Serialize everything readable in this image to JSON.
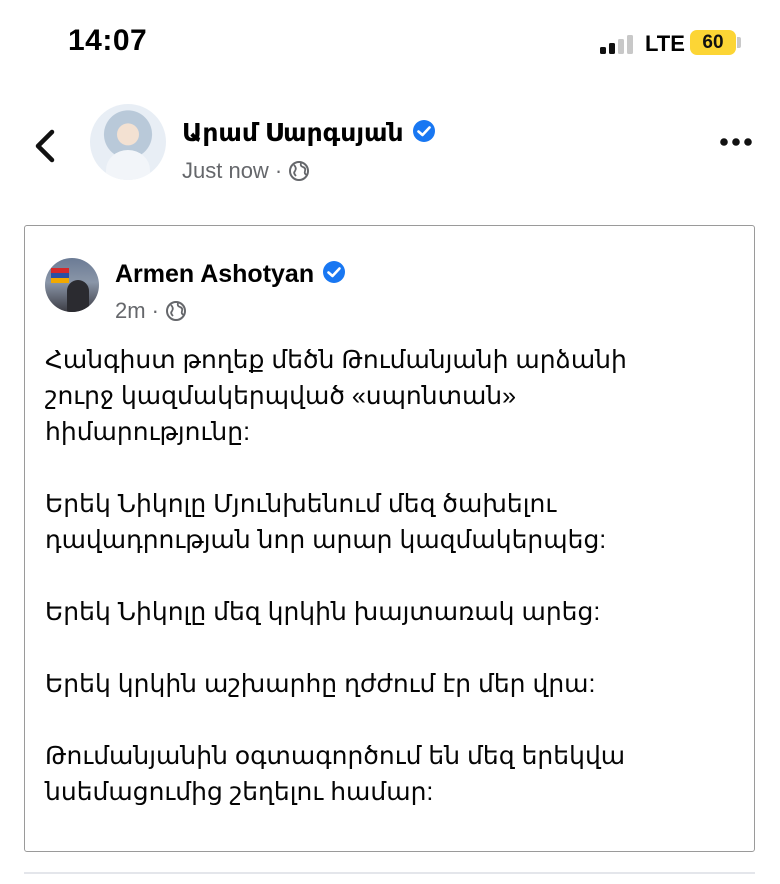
{
  "status_bar": {
    "time": "14:07",
    "network": "LTE",
    "battery": "60",
    "battery_color": "#fcd535",
    "signal_bars_filled": 2,
    "signal_bars_total": 4
  },
  "post": {
    "author": "Արամ Սարգսյան",
    "verified": true,
    "time": "Just now",
    "separator": "·",
    "audience_icon": "globe-icon"
  },
  "shared": {
    "author": "Armen Ashotyan",
    "verified": true,
    "time": "2m",
    "separator": "·",
    "audience_icon": "globe-icon",
    "paragraphs": [
      {
        "line1": "Հանգիստ թողեք մեծն Թումանյանի արձանի",
        "line2": "շուրջ կազմակերպված «սպոնտան»",
        "line3": "հիմարությունը:"
      },
      {
        "line1": "Երեկ Նիկոլը Մյունխենում մեզ ծախելու",
        "line2": "դավադրության նոր արար կազմակերպեց:"
      },
      {
        "line1": "Երեկ Նիկոլը մեզ կրկին խայտառակ արեց:"
      },
      {
        "line1": "Երեկ կրկին աշխարհը ղժժում էր մեր վրա:"
      },
      {
        "line1": "Թումանյանին օգտագործում են մեզ երեկվա",
        "line2": "նսեմացումից շեղելու համար:"
      }
    ]
  },
  "colors": {
    "verified_badge": "#1877f2",
    "meta_text": "#65676b"
  }
}
